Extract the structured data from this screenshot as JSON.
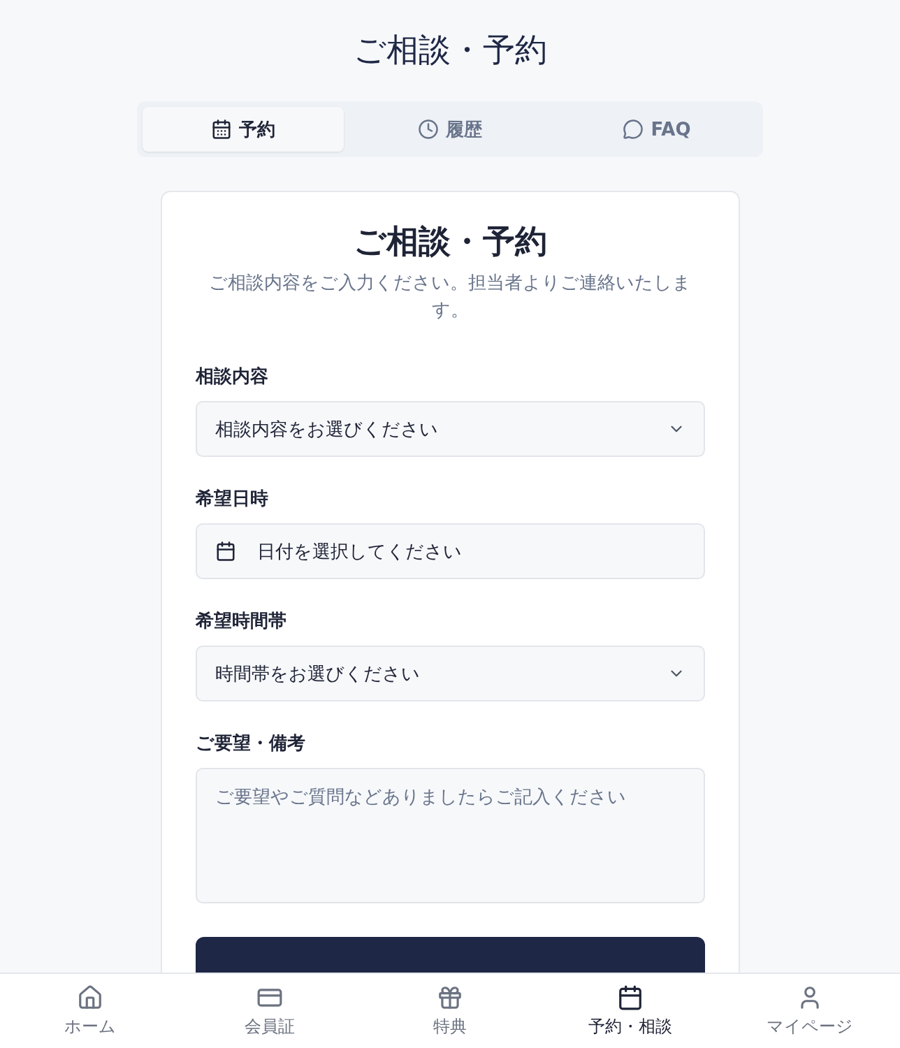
{
  "page_title": "ご相談・予約",
  "tabs": [
    {
      "label": "予約",
      "kind": "calendar",
      "selected": true
    },
    {
      "label": "履歴",
      "kind": "clock",
      "selected": false
    },
    {
      "label": "FAQ",
      "kind": "chat",
      "selected": false
    }
  ],
  "form": {
    "title": "ご相談・予約",
    "subtitle": "ご相談内容をご入力ください。担当者よりご連絡いたします。",
    "fields": [
      {
        "kind": "select",
        "label": "相談内容",
        "value": "相談内容をお選びください"
      },
      {
        "kind": "date",
        "label": "希望日時",
        "value": "日付を選択してください"
      },
      {
        "kind": "select",
        "label": "希望時間帯",
        "value": "時間帯をお選びください"
      },
      {
        "kind": "textarea",
        "label": "ご要望・備考",
        "placeholder": "ご要望やご質問などありましたらご記入ください"
      }
    ]
  },
  "bottom_nav": [
    {
      "label": "ホーム",
      "kind": "home",
      "selected": false
    },
    {
      "label": "会員証",
      "kind": "card",
      "selected": false
    },
    {
      "label": "特典",
      "kind": "gift",
      "selected": false
    },
    {
      "label": "予約・相談",
      "kind": "calendar",
      "selected": true
    },
    {
      "label": "マイページ",
      "kind": "user",
      "selected": false
    }
  ]
}
